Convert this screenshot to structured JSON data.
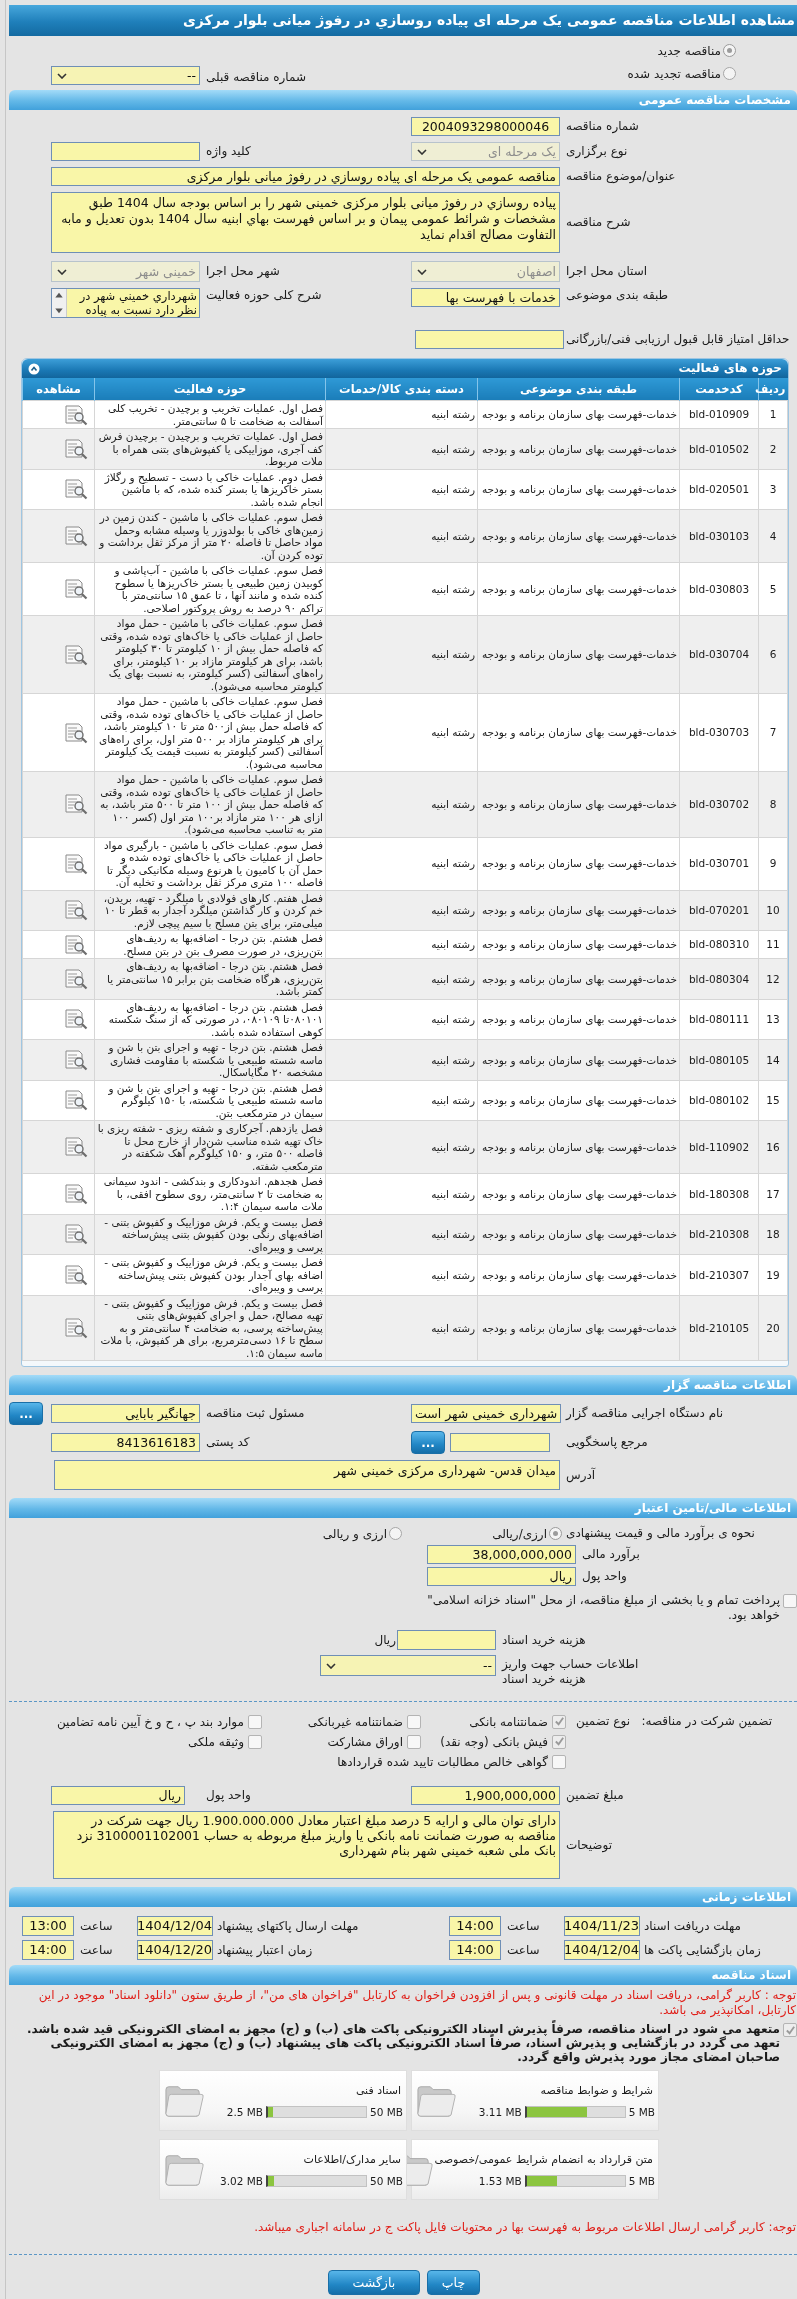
{
  "page_title": "مشاهده اطلاعات مناقصه عمومی یک مرحله ای پیاده روسازي در رفوژ میانی بلوار مرکزی",
  "tender_kind": [
    {
      "label": "مناقصه جدید",
      "selected": true
    },
    {
      "label": "مناقصه تجدید شده",
      "selected": false
    }
  ],
  "previous_tender": {
    "label": "شماره مناقصه قبلی",
    "value": "--",
    "disabled": false
  },
  "general": {
    "heading": "مشخصات مناقصه عمومی",
    "tender_number": {
      "label": "شماره مناقصه",
      "value": "2004093298000046"
    },
    "holding_type": {
      "label": "نوع برگزاری",
      "value": "یک مرحله ای",
      "disabled": true
    },
    "keyword": {
      "label": "کلید واژه"
    },
    "subject": {
      "label": "عنوان/موضوع مناقصه",
      "value": "مناقصه عمومی یک مرحله ای پیاده روسازي در رفوژ میانی بلوار مرکزی"
    },
    "description": {
      "label": "شرح مناقصه",
      "value": "پیاده روسازي در رفوژ میانی بلوار مرکزی خمینی شهر را بر اساس بودجه سال 1404 طبق مشخصات و شرائط عمومی پیمان و بر اساس فهرست بهاي ابنیه سال 1404 بدون تعدیل و مابه التفاوت مصالح اقدام نماید"
    },
    "province": {
      "label": "استان محل اجرا",
      "value": "اصفهان",
      "disabled": true
    },
    "city": {
      "label": "شهر محل اجرا",
      "value": "خمینی شهر",
      "disabled": true
    },
    "subject_category": {
      "label": "طبقه بندی موضوعی",
      "value": "خدمات با فهرست بها"
    },
    "activity_summary": {
      "label": "شرح کلی حوزه فعالیت",
      "value": "شهرداري خميني شهر در نظر دارد نسبت به پياده"
    },
    "min_score": {
      "label": "حداقل امتیاز قابل قبول ارزیابی فنی/بازرگانی"
    }
  },
  "activities": {
    "heading": "حوزه های فعالیت",
    "columns": [
      "ردیف",
      "کدخدمت",
      "طبقه بندی موضوعی",
      "دسته بندی کالا/خدمات",
      "حوزه فعالیت",
      "مشاهده"
    ],
    "rows": [
      {
        "row": "1",
        "code": "bld-010909",
        "category": "خدمات-فهرست بهای سازمان برنامه و بودجه",
        "group": "رشته ابنیه",
        "activity": "فصل اول. عملیات تخریب و برچیدن - تخریب کلی آسفالت  به ضخامت تا ۵ سانتی‌متر."
      },
      {
        "row": "2",
        "code": "bld-010502",
        "category": "خدمات-فهرست بهای سازمان برنامه و بودجه",
        "group": "رشته ابنیه",
        "activity": "فصل اول. عملیات تخریب و برچیدن - برچیدن فرش کف آجری، موزاییکی یا کفپوش‌های بتنی همراه با ملات مربوط."
      },
      {
        "row": "3",
        "code": "bld-020501",
        "category": "خدمات-فهرست بهای سازمان برنامه و بودجه",
        "group": "رشته ابنیه",
        "activity": "فصل دوم. عملیات خاکی با دست - تسطیح و رگلاژ بستر خاکریزها یا بستر کنده شده، که با ماشین انجام شده باشد."
      },
      {
        "row": "4",
        "code": "bld-030103",
        "category": "خدمات-فهرست بهای سازمان برنامه و بودجه",
        "group": "رشته ابنیه",
        "activity": "فصل سوم. عملیات خاکی با ماشین - کندن زمین در زمین‌های خاکی با بولدوزر یا وسیله مشابه وحمل مواد حاصل تا فاصله ۲۰ متر از مرکز ثقل برداشت و توده کردن آن."
      },
      {
        "row": "5",
        "code": "bld-030803",
        "category": "خدمات-فهرست بهای سازمان برنامه و بودجه",
        "group": "رشته ابنیه",
        "activity": "فصل سوم. عملیات خاکی با ماشین - آب‌پاشی و کوبیدن زمین طبیعی یا بستر خاک‌ریزها یا سطوح کنده شده و مانند آنها ، تا عمق ۱۵ سانتی‌متر با تراکم ۹۰ درصد به روش پروکتور اصلاحی."
      },
      {
        "row": "6",
        "code": "bld-030704",
        "category": "خدمات-فهرست بهای سازمان برنامه و بودجه",
        "group": "رشته ابنیه",
        "activity": "فصل سوم. عملیات خاکی با ماشین - حمل مواد حاصل از عملیات خاکی یا خاک‌های توده شده، وقتی که فاصله حمل بیش از ۱۰ کیلومتر تا ۳۰ کیلومتر باشد، برای هر کیلومتر مازاد بر ۱۰ کیلومتر، برای راه‌های آسفالتی (کسر کیلومتر، به نسبت بهای یک کیلومتر محاسبه می‌شود)."
      },
      {
        "row": "7",
        "code": "bld-030703",
        "category": "خدمات-فهرست بهای سازمان برنامه و بودجه",
        "group": "رشته ابنیه",
        "activity": "فصل سوم. عملیات خاکی با ماشین - حمل مواد حاصل از عملیات خاکی یا خاک‌های توده شده، وقتی  که فاصله حمل بیش از۵۰۰ متر تا ۱۰ کیلومتر باشد، برای هر کیلومتر مازاد بر ۵۰۰  متر اول، برای راه‌های آسفالتی (کسر کیلومتر به نسبت قیمت یک کیلومتر محاسبه می‌شود)."
      },
      {
        "row": "8",
        "code": "bld-030702",
        "category": "خدمات-فهرست بهای سازمان برنامه و بودجه",
        "group": "رشته ابنیه",
        "activity": "فصل سوم. عملیات خاکی با ماشین - حمل مواد حاصل از عملیات خاکی یا خاک‌های توده شده، وقتی که فاصله حمل بیش از ۱۰۰ متر تا ۵۰۰ متر باشد، به ازای هر ۱۰۰ متر مازاد بر۱۰۰ متر اول (کسر ۱۰۰ متر به تناسب محاسبه می‌شود)."
      },
      {
        "row": "9",
        "code": "bld-030701",
        "category": "خدمات-فهرست بهای سازمان برنامه و بودجه",
        "group": "رشته ابنیه",
        "activity": "فصل سوم. عملیات خاکی با ماشین - بارگیری مواد حاصل از عملیات خاکی یا خاک‌های توده شده و حمل آن با کامیون یا هرنوع وسیله مکانیکی دیگر تا فاصله ۱۰۰ متری مرکز ثقل  برداشت و تخلیه آن."
      },
      {
        "row": "10",
        "code": "bld-070201",
        "category": "خدمات-فهرست بهای سازمان برنامه و بودجه",
        "group": "رشته ابنیه",
        "activity": "فصل هفتم. کارهای فولادی با میلگرد - تهیه، بریدن، خم کردن و کار گذاشتن میلگرد آجدار به قطر تا ۱۰ میلی‌متر، برای بتن مسلح با سیم پیچی لازم."
      },
      {
        "row": "11",
        "code": "bld-080310",
        "category": "خدمات-فهرست بهای سازمان برنامه و بودجه",
        "group": "رشته ابنیه",
        "activity": "فصل هشتم. بتن درجا - اضافه‌بها به ردیف‌های بتن‌ریزی، در صورت مصرف بتن در بتن مسلح."
      },
      {
        "row": "12",
        "code": "bld-080304",
        "category": "خدمات-فهرست بهای سازمان برنامه و بودجه",
        "group": "رشته ابنیه",
        "activity": "فصل هشتم. بتن درجا - اضافه‌بها به ردیف‌های بتن‌ریزی، هرگاه ضخامت بتن برابر ۱۵ سانتی‌متر یا کمتر باشد."
      },
      {
        "row": "13",
        "code": "bld-080111",
        "category": "خدمات-فهرست بهای سازمان برنامه و بودجه",
        "group": "رشته ابنیه",
        "activity": "فصل هشتم. بتن درجا - اضافه‌بها به ردیف‌های ۰۸۰۱۰۱تا ۰۸۰۱۰۹، در صورتی که از سنگ شکسته کوهی استفاده شده باشد."
      },
      {
        "row": "14",
        "code": "bld-080105",
        "category": "خدمات-فهرست بهای سازمان برنامه و بودجه",
        "group": "رشته ابنیه",
        "activity": "فصل هشتم. بتن درجا - تهیه و اجرای بتن با شن و ماسه شسته طبیعی یا شکسته با مقاومت فشاری مشخصه ۲۰ مگاپاسکال."
      },
      {
        "row": "15",
        "code": "bld-080102",
        "category": "خدمات-فهرست بهای سازمان برنامه و بودجه",
        "group": "رشته ابنیه",
        "activity": "فصل هشتم. بتن درجا - تهیه و اجرای بتن با شن و ماسه شسته طبیعی یا شکسته، با ۱۵۰ کیلوگرم سیمان در مترمکعب بتن."
      },
      {
        "row": "16",
        "code": "bld-110902",
        "category": "خدمات-فهرست بهای سازمان برنامه و بودجه",
        "group": "رشته ابنیه",
        "activity": "فصل یازدهم. آجرکاری و شفته ریزی - شفته ریزی با خاک تهیه شده مناسب شن‌دار از خارج محل تا فاصله ۵۰۰ متر، و ۱۵۰ کیلوگرم آهک شکفته در مترمکعب شفته."
      },
      {
        "row": "17",
        "code": "bld-180308",
        "category": "خدمات-فهرست بهای سازمان برنامه و بودجه",
        "group": "رشته ابنیه",
        "activity": "فصل هجدهم. اندودکاری و بندکشی - اندود سیمانی به ضخامت تا ۲ سانتی‌متر، روی سطوح افقی، با ملات ماسه سیمان ۱:۴."
      },
      {
        "row": "18",
        "code": "bld-210308",
        "category": "خدمات-فهرست بهای سازمان برنامه و بودجه",
        "group": "رشته ابنیه",
        "activity": "فصل بیست و یکم. فرش موزاییک و کفپوش بتنی - اضافه‌بهای رنگی بودن کفپوش بتنی پیش‌ساخته پرسی و ویبره‌ای."
      },
      {
        "row": "19",
        "code": "bld-210307",
        "category": "خدمات-فهرست بهای سازمان برنامه و بودجه",
        "group": "رشته ابنیه",
        "activity": "فصل بیست و یکم. فرش موزاییک و کفپوش بتنی - اضافه بهای آجدار بودن کفپوش بتنی پیش‌ساخته پرسی و ویبره‌ای."
      },
      {
        "row": "20",
        "code": "bld-210105",
        "category": "خدمات-فهرست بهای سازمان برنامه و بودجه",
        "group": "رشته ابنیه",
        "activity": "فصل بیست و یکم. فرش موزاییک و کفپوش بتنی - تهیه مصالح، حمل و اجرای کفپوش‌های بتنی پیش‌ساخته پرسی، به ضخامت ۴ سانتی‌متر و به سطح تا ۱۶ دسی‌مترمربع، برای هر کفپوش، با ملات ماسه سیمان ۱:۵."
      }
    ]
  },
  "tenderer": {
    "heading": "اطلاعات مناقصه گزار",
    "organization": {
      "label": "نام دستگاه اجرایی مناقصه گزار",
      "value": "شهرداری خمینی شهر است"
    },
    "registrar": {
      "label": "مسئول ثبت مناقصه",
      "value": "جهانگیر بابایی",
      "button": "..."
    },
    "responder": {
      "label": "مرجع پاسخگویی",
      "button": "..."
    },
    "postal_code": {
      "label": "کد پستی",
      "value": "8413616183"
    },
    "address": {
      "label": "آدرس",
      "value": "میدان قدس- شهرداری مرکزی خمینی شهر"
    }
  },
  "finance": {
    "heading": "اطلاعات مالی/تامین اعتبار",
    "estimate_method": {
      "label": "نحوه ی برآورد مالی و قیمت پیشنهادی",
      "options": [
        {
          "label": "ارزی/ریالی",
          "selected": true
        },
        {
          "label": "ارزی و ریالی",
          "selected": false
        }
      ]
    },
    "estimate": {
      "label": "برآورد مالی",
      "value": "38,000,000,000"
    },
    "currency": {
      "label": "واحد پول",
      "value": "ریال"
    },
    "treasury_bonds": {
      "label": "پرداخت تمام و یا بخشی از مبلغ مناقصه، از محل \"اسناد خزانه اسلامی\" خواهد بود.",
      "checked": false
    },
    "document_fee": {
      "label": "هزینه خرید اسناد",
      "unit": "ریال"
    },
    "fee_account": {
      "label": "اطلاعات حساب جهت واریز هزینه خرید اسناد",
      "value": "--",
      "disabled": false
    },
    "guarantee": {
      "label": "تضمین شرکت در مناقصه:",
      "type_label": "نوع تضمین",
      "types": [
        {
          "label": "ضمانتنامه بانکی",
          "checked": true
        },
        {
          "label": "ضمانتنامه غیربانکی",
          "checked": false
        },
        {
          "label": "موارد بند پ ، ح و خ آیین نامه تضامین",
          "checked": false
        },
        {
          "label": "فیش بانکی (وجه نقد)",
          "checked": true
        },
        {
          "label": "اوراق مشارکت",
          "checked": false
        },
        {
          "label": "وثیقه ملکی",
          "checked": false
        },
        {
          "label": "گواهی خالص مطالبات تایید شده قراردادها",
          "checked": false
        }
      ],
      "amount": {
        "label": "مبلغ تضمین",
        "value": "1,900,000,000"
      },
      "currency": {
        "label": "واحد پول",
        "value": "ریال"
      },
      "notes": {
        "label": "توضیحات",
        "value": "دارای توان مالی و ارایه 5 درصد مبلغ اعتبار معادل 1.900.000.000 ریال جهت شرکت در مناقصه به صورت ضمانت نامه بانکی یا واریز مبلغ مربوطه به حساب 3100001102001 نزد بانک ملی شعبه خمینی شهر بنام شهرداری"
      }
    }
  },
  "schedule": {
    "heading": "اطلاعات زمانی",
    "items": [
      {
        "label": "مهلت دریافت اسناد",
        "date": "1404/11/23",
        "time_label": "ساعت",
        "time": "14:00"
      },
      {
        "label": "مهلت ارسال پاکتهای پیشنهاد",
        "date": "1404/12/04",
        "time_label": "ساعت",
        "time": "13:00"
      },
      {
        "label": "زمان بازگشایی پاکت ها",
        "date": "1404/12/04",
        "time_label": "ساعت",
        "time": "14:00"
      },
      {
        "label": "زمان اعتبار پیشنهاد",
        "date": "1404/12/20",
        "time_label": "ساعت",
        "time": "14:00"
      }
    ]
  },
  "documents": {
    "heading": "اسناد مناقصه",
    "notice": "توجه : کاربر گرامی، دریافت اسناد در مهلت قانونی و پس از افزودن فراخوان به کارتابل \"فراخوان های من\"، از طریق ستون \"دانلود اسناد\" موجود در این کارتابل، امکانپذیر می باشد.",
    "commitment": {
      "text": "متعهد می شود در اسناد مناقصه، صرفاً پذیرش اسناد الکترونیکی پاکت های (ب) و (ج) مجهز به امضای الکترونیکی قید شده باشد. تعهد می گردد در بازگشایی و پذیرش اسناد، صرفاً اسناد الکترونیکی پاکت های پیشنهاد (ب) و (ج) مجهز به امضای الکترونیکی صاحبان امضای مجاز مورد پذیرش واقع گردد.",
      "checked": true
    },
    "files": [
      {
        "name": "شرایط و ضوابط مناقصه",
        "size": "3.11 MB",
        "limit": "5 MB",
        "level": 0.62
      },
      {
        "name": "اسناد فنی",
        "size": "2.5 MB",
        "limit": "50 MB",
        "level": 0.05
      },
      {
        "name": "متن قرارداد به انضمام شرایط عمومی/خصوصی",
        "size": "1.53 MB",
        "limit": "5 MB",
        "level": 0.31
      },
      {
        "name": "سایر مدارک/اطلاعات",
        "size": "3.02 MB",
        "limit": "50 MB",
        "level": 0.06
      }
    ],
    "footer_notice": "توجه: کاربر گرامی ارسال اطلاعات مربوط به فهرست بها در محتویات فایل پاکت ج در سامانه اجباری میباشد."
  },
  "buttons": [
    "چاپ",
    "بازگشت"
  ]
}
